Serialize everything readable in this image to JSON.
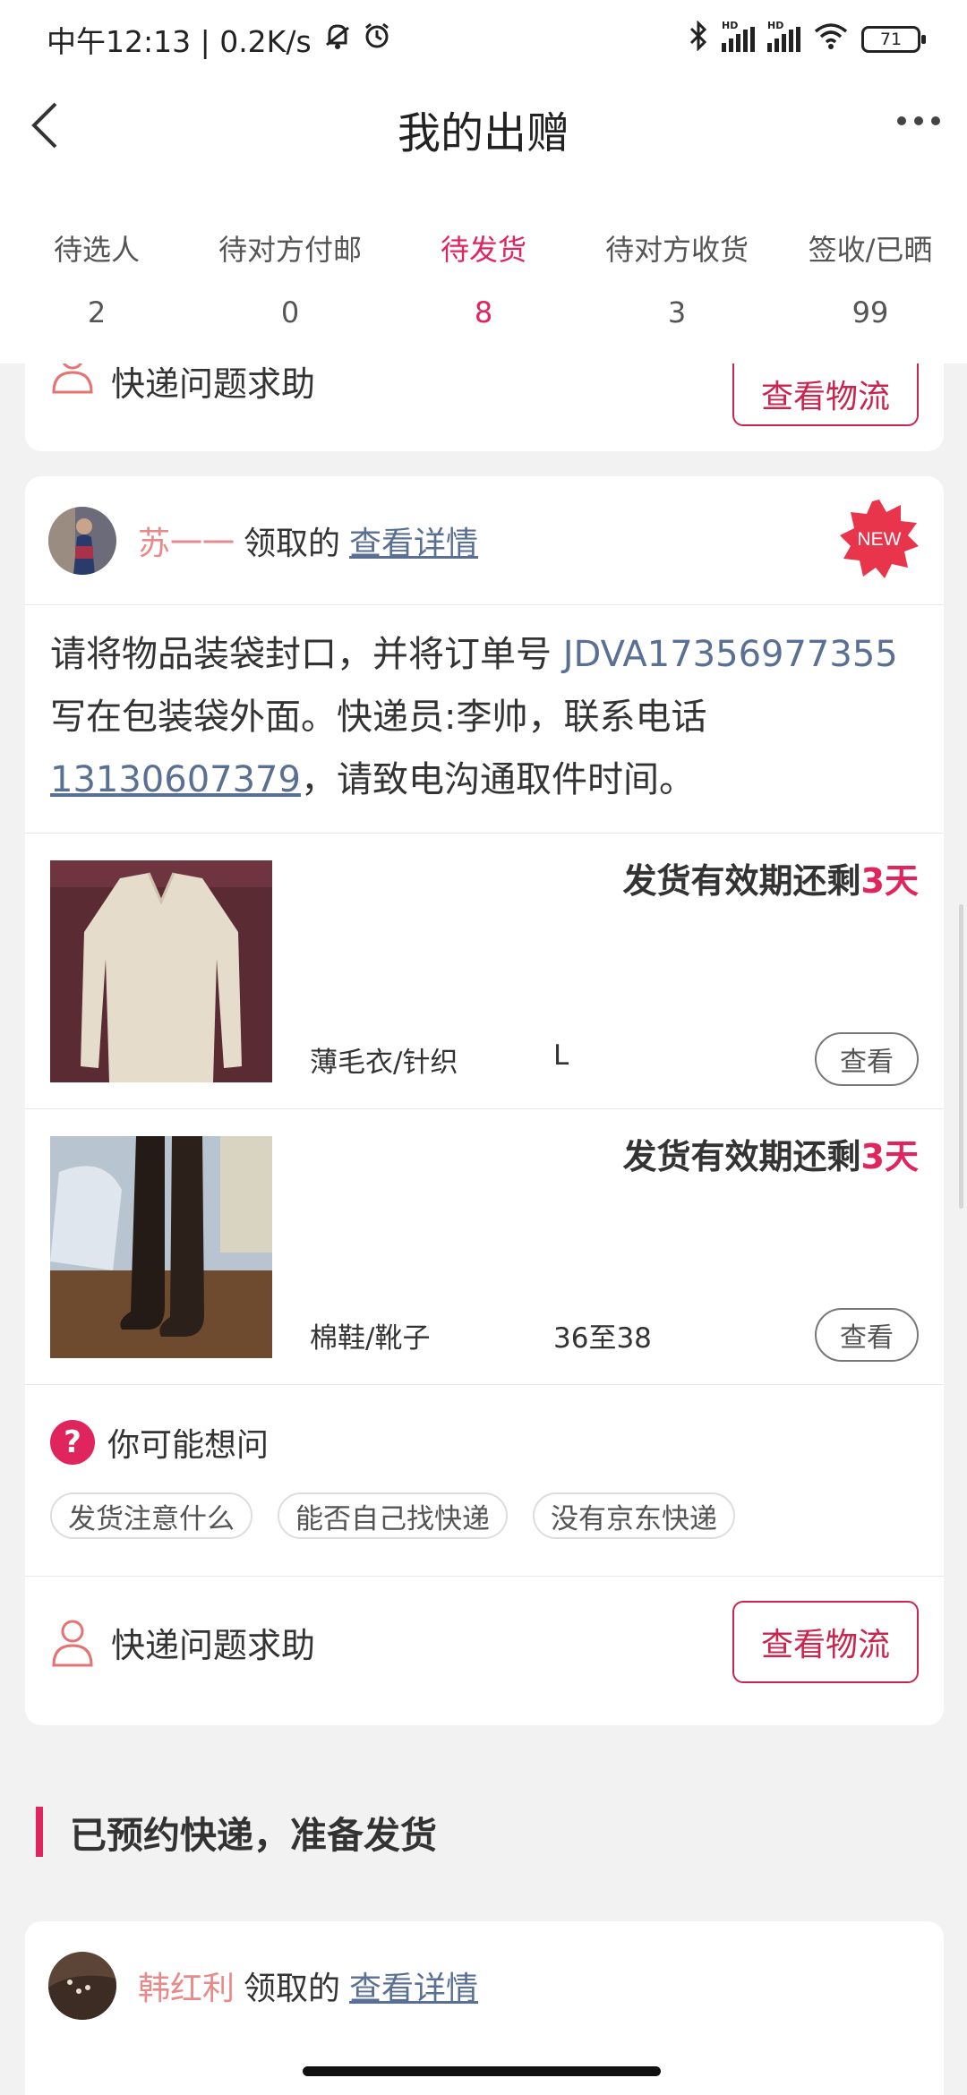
{
  "status_bar": {
    "time_speed": "中午12:13 | 0.2K/s",
    "hd1": "HD",
    "hd2": "HD",
    "battery": "71",
    "icons": [
      "mute-bell-icon",
      "alarm-icon",
      "bluetooth-icon",
      "signal-icon",
      "signal-icon",
      "wifi-icon",
      "battery-icon"
    ]
  },
  "header": {
    "title": "我的出赠",
    "back_icon": "chevron-left-icon",
    "more_icon": "more-dots-icon"
  },
  "tabs": [
    {
      "label": "待选人",
      "count": "2"
    },
    {
      "label": "待对方付邮",
      "count": "0"
    },
    {
      "label": "待发货",
      "count": "8",
      "active": true
    },
    {
      "label": "待对方收货",
      "count": "3"
    },
    {
      "label": "签收/已晒",
      "count": "99"
    }
  ],
  "top_partial_card": {
    "help_text": "快递问题求助",
    "logistics_button": "查看物流"
  },
  "order_card": {
    "recipient_name": "苏一一",
    "received_text": "领取的",
    "details_link": "查看详情",
    "new_badge": "NEW",
    "notice": {
      "part1": "请将物品装袋封口，并将订单号 ",
      "order_no": "JDVA17356977355",
      "part2": " 写在包装袋外面。快递员:李帅，联系电话",
      "phone": "13130607379",
      "part3": "，请致电沟通取件时间。"
    },
    "items": [
      {
        "deadline_prefix": "发货有效期还剩",
        "deadline_days": "3天",
        "category": "薄毛衣/针织",
        "size": "L",
        "view_button": "查看"
      },
      {
        "deadline_prefix": "发货有效期还剩",
        "deadline_days": "3天",
        "category": "棉鞋/靴子",
        "size": "36至38",
        "view_button": "查看"
      }
    ],
    "faq": {
      "title": "你可能想问",
      "icon": "question-circle-icon",
      "chips": [
        "发货注意什么",
        "能否自己找快递",
        "没有京东快递"
      ]
    },
    "help_text": "快递问题求助",
    "logistics_button": "查看物流"
  },
  "section": {
    "title": "已预约快递，准备发货"
  },
  "next_card": {
    "recipient_name": "韩红利",
    "received_text": "领取的",
    "details_link": "查看详情"
  },
  "colors": {
    "accent": "#e0245e",
    "link": "#5a6f94",
    "name": "#e88a8a",
    "background": "#f2f2f2"
  }
}
